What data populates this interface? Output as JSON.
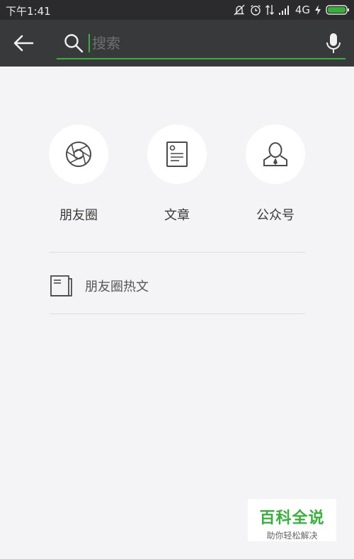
{
  "status_bar": {
    "time": "下午1:41",
    "network": "4G"
  },
  "search": {
    "placeholder": "搜索"
  },
  "categories": [
    {
      "label": "朋友圈",
      "icon": "aperture-icon"
    },
    {
      "label": "文章",
      "icon": "article-icon"
    },
    {
      "label": "公众号",
      "icon": "official-account-icon"
    }
  ],
  "hot_articles": {
    "label": "朋友圈热文",
    "icon": "newspaper-icon"
  },
  "watermark": {
    "title": "百科全说",
    "subtitle": "助你轻松解决"
  },
  "colors": {
    "accent": "#35b13a",
    "toolbar": "#38393b",
    "statusbar": "#2b2b2d",
    "background": "#f4f4f6"
  }
}
